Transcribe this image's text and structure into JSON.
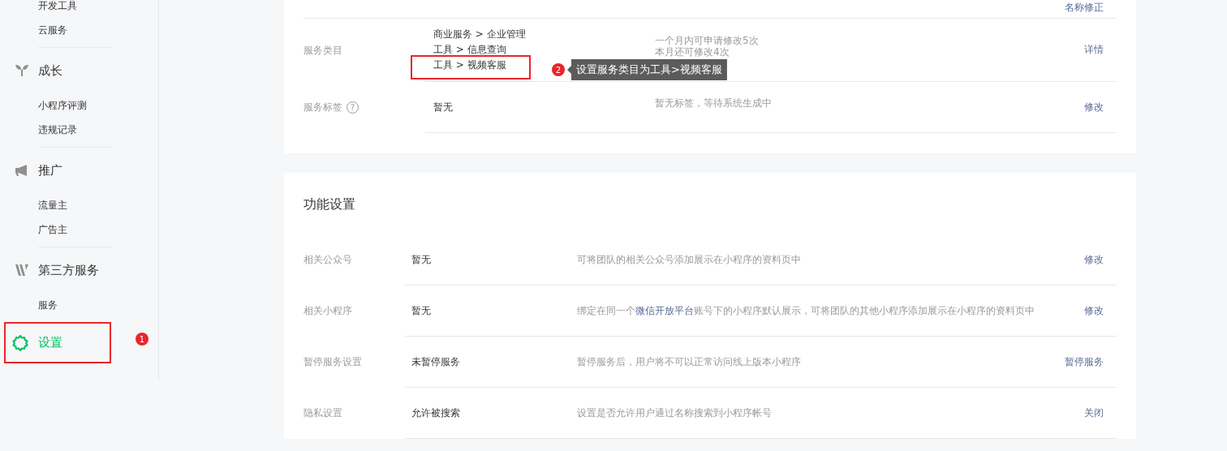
{
  "sidebar": {
    "groups": [
      {
        "items": [
          {
            "label": "开发工具",
            "selected": false
          },
          {
            "label": "云服务",
            "selected": false
          }
        ]
      },
      {
        "title": "成长",
        "items": [
          {
            "label": "小程序评测",
            "selected": false
          },
          {
            "label": "违规记录",
            "selected": false
          }
        ]
      },
      {
        "title": "推广",
        "items": [
          {
            "label": "流量主",
            "selected": false
          },
          {
            "label": "广告主",
            "selected": false
          }
        ]
      },
      {
        "title": "第三方服务",
        "items": [
          {
            "label": "服务",
            "selected": false
          }
        ]
      }
    ],
    "settings": {
      "label": "设置",
      "selected": true,
      "callout": "1"
    }
  },
  "basic_card": {
    "top_action": "名称修正",
    "rows": [
      {
        "label": "服务类目",
        "categories": [
          {
            "text": "商业服务 > 企业管理",
            "highlighted": false
          },
          {
            "text": "工具 > 信息查询",
            "highlighted": false
          },
          {
            "text": "工具 > 视频客服",
            "highlighted": true,
            "callout": {
              "badge": "2",
              "text": "设置服务类目为工具>视频客服"
            }
          }
        ],
        "desc": [
          "一个月内可申请修改5次",
          "本月还可修改4次"
        ],
        "action": "详情"
      },
      {
        "label": "服务标签",
        "help": "?",
        "categories": [
          {
            "text": "暂无",
            "highlighted": false
          }
        ],
        "desc": [
          "暂无标签，等待系统生成中"
        ],
        "action": "修改"
      }
    ]
  },
  "feature_card": {
    "title": "功能设置",
    "rows": [
      {
        "label": "相关公众号",
        "value": "暂无",
        "desc": [
          {
            "kind": "text",
            "text": "可将团队的相关公众号添加展示在小程序的资料页中"
          }
        ],
        "action": "修改"
      },
      {
        "label": "相关小程序",
        "value": "暂无",
        "desc": [
          {
            "kind": "text",
            "text": "绑定在同一个"
          },
          {
            "kind": "link",
            "text": "微信开放平台"
          },
          {
            "kind": "text",
            "text": "账号下的小程序默认展示，可将团队的其他小程序添加展示在小程序的资料页中"
          }
        ],
        "action": "修改"
      },
      {
        "label": "暂停服务设置",
        "value": "未暂停服务",
        "desc": [
          {
            "kind": "text",
            "text": "暂停服务后，用户将不可以正常访问线上版本小程序"
          }
        ],
        "action": "暂停服务"
      },
      {
        "label": "隐私设置",
        "value": "允许被搜索",
        "desc": [
          {
            "kind": "text",
            "text": "设置是否允许用户通过名称搜索到小程序帐号"
          }
        ],
        "action": "关闭"
      }
    ]
  }
}
